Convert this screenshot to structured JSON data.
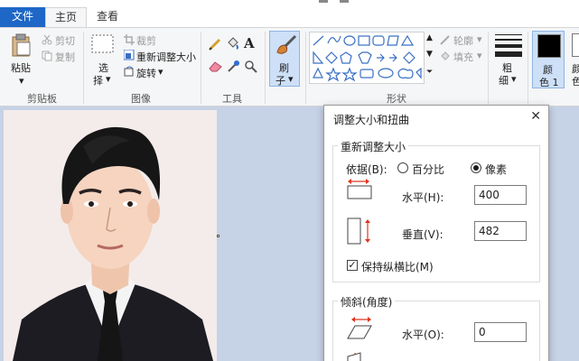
{
  "tabs": {
    "file": "文件",
    "home": "主页",
    "view": "查看"
  },
  "ribbon": {
    "clipboard": {
      "paste": "粘贴",
      "cut": "剪切",
      "copy": "复制",
      "group": "剪贴板"
    },
    "image": {
      "select_line1": "选",
      "select_line2": "择",
      "crop": "裁剪",
      "resize": "重新调整大小",
      "rotate": "旋转",
      "group": "图像"
    },
    "tools": {
      "group": "工具"
    },
    "brush": {
      "line1": "刷",
      "line2": "子"
    },
    "shapes": {
      "outline": "轮廓",
      "fill": "填充",
      "group": "形状"
    },
    "size": {
      "line1": "粗",
      "line2": "细"
    },
    "color1": {
      "line1": "颜",
      "line2": "色 1"
    },
    "color2": {
      "line1": "颜",
      "line2": "色"
    }
  },
  "dialog": {
    "title": "调整大小和扭曲",
    "resize_group": "重新调整大小",
    "by_label": "依据(B):",
    "percent": "百分比",
    "pixels": "像素",
    "horizontal_label": "水平(H):",
    "horizontal_value": "400",
    "vertical_label": "垂直(V):",
    "vertical_value": "482",
    "keep_ratio": "保持纵横比(M)",
    "skew_group": "倾斜(角度)",
    "skew_horizontal_label": "水平(O):",
    "skew_horizontal_value": "0"
  },
  "colors": {
    "accent": "#1e67c6",
    "arrow": "#e0341e"
  }
}
